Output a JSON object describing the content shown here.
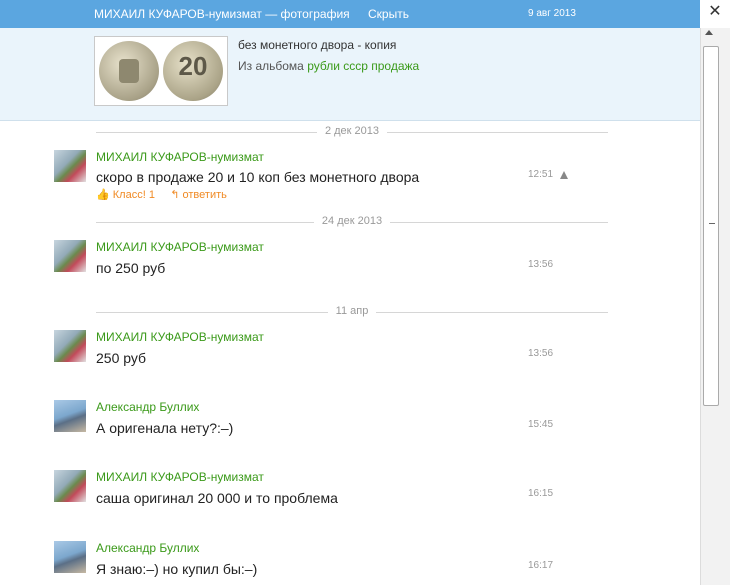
{
  "header": {
    "title": "МИХАИЛ КУФАРОВ-нумизмат — фотография",
    "hide_label": "Скрыть",
    "date": "9 авг 2013",
    "close_glyph": "✕"
  },
  "photo": {
    "title": "без монетного двора - копия",
    "album_prefix": "Из альбома",
    "album_name": "рубли ссср продажа",
    "coin_numeral": "20"
  },
  "separators": [
    "2 дек 2013",
    "24 дек 2013",
    "11 апр"
  ],
  "messages": [
    {
      "author": "МИХАИЛ КУФАРОВ-нумизмат",
      "text": "скоро в продаже 20 и 10 коп без монетного двора",
      "time": "12:51",
      "like": "Класс! 1",
      "reply": "ответить"
    },
    {
      "author": "МИХАИЛ КУФАРОВ-нумизмат",
      "text": "по 250 руб",
      "time": "13:56"
    },
    {
      "author": "МИХАИЛ КУФАРОВ-нумизмат",
      "text": "250 руб",
      "time": "13:56"
    },
    {
      "author": "Александр Буллих",
      "text": "А оригенала нету?:–)",
      "time": "15:45"
    },
    {
      "author": "МИХАИЛ КУФАРОВ-нумизмат",
      "text": "саша оригинал 20 000 и то проблема",
      "time": "16:15"
    },
    {
      "author": "Александр Буллих",
      "text": "Я знаю:–) но купил бы:–)",
      "time": "16:17"
    }
  ],
  "colors": {
    "accent": "#5ba6e0",
    "link": "#3b9a1a",
    "action": "#f08a24"
  }
}
